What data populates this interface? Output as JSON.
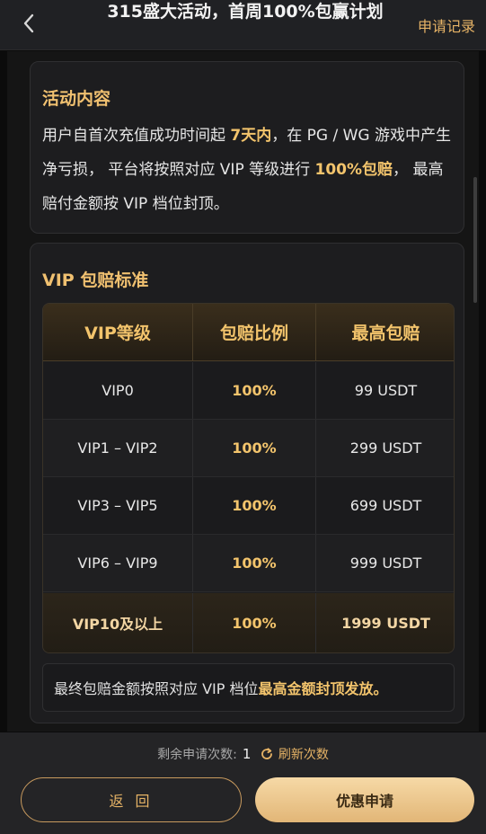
{
  "header": {
    "title": "315盛大活动，首周100%包赢计划",
    "records_label": "申请记录"
  },
  "activity": {
    "title": "活动内容",
    "desc_part1": "用户自首次充值成功时间起 ",
    "desc_hl1": "7天内",
    "desc_part2": "，在 PG / WG 游戏中产生净亏损， 平台将按照对应 VIP 等级进行 ",
    "desc_hl2": "100%包赔",
    "desc_part3": "， 最高赔付金额按 VIP 档位封顶。"
  },
  "standard": {
    "title": "VIP 包赔标准",
    "headers": [
      "VIP等级",
      "包赔比例",
      "最高包赔"
    ],
    "rows": [
      {
        "level": "VIP0",
        "ratio": "100%",
        "max": "99 USDT"
      },
      {
        "level": "VIP1 – VIP2",
        "ratio": "100%",
        "max": "299 USDT"
      },
      {
        "level": "VIP3 – VIP5",
        "ratio": "100%",
        "max": "699 USDT"
      },
      {
        "level": "VIP6 – VIP9",
        "ratio": "100%",
        "max": "999 USDT"
      },
      {
        "level": "VIP10及以上",
        "ratio": "100%",
        "max": "1999 USDT"
      }
    ],
    "note_text": "最终包赔金额按照对应 VIP 档位 ",
    "note_hl": "最高金额封顶发放。"
  },
  "footer": {
    "remaining_label": "剩余申请次数:",
    "remaining_count": "1",
    "refresh_label": "刷新次数",
    "back_label": "返 回",
    "apply_label": "优惠申请"
  },
  "colors": {
    "accent": "#f3c46c",
    "link": "#e6b366",
    "background": "#151515"
  }
}
